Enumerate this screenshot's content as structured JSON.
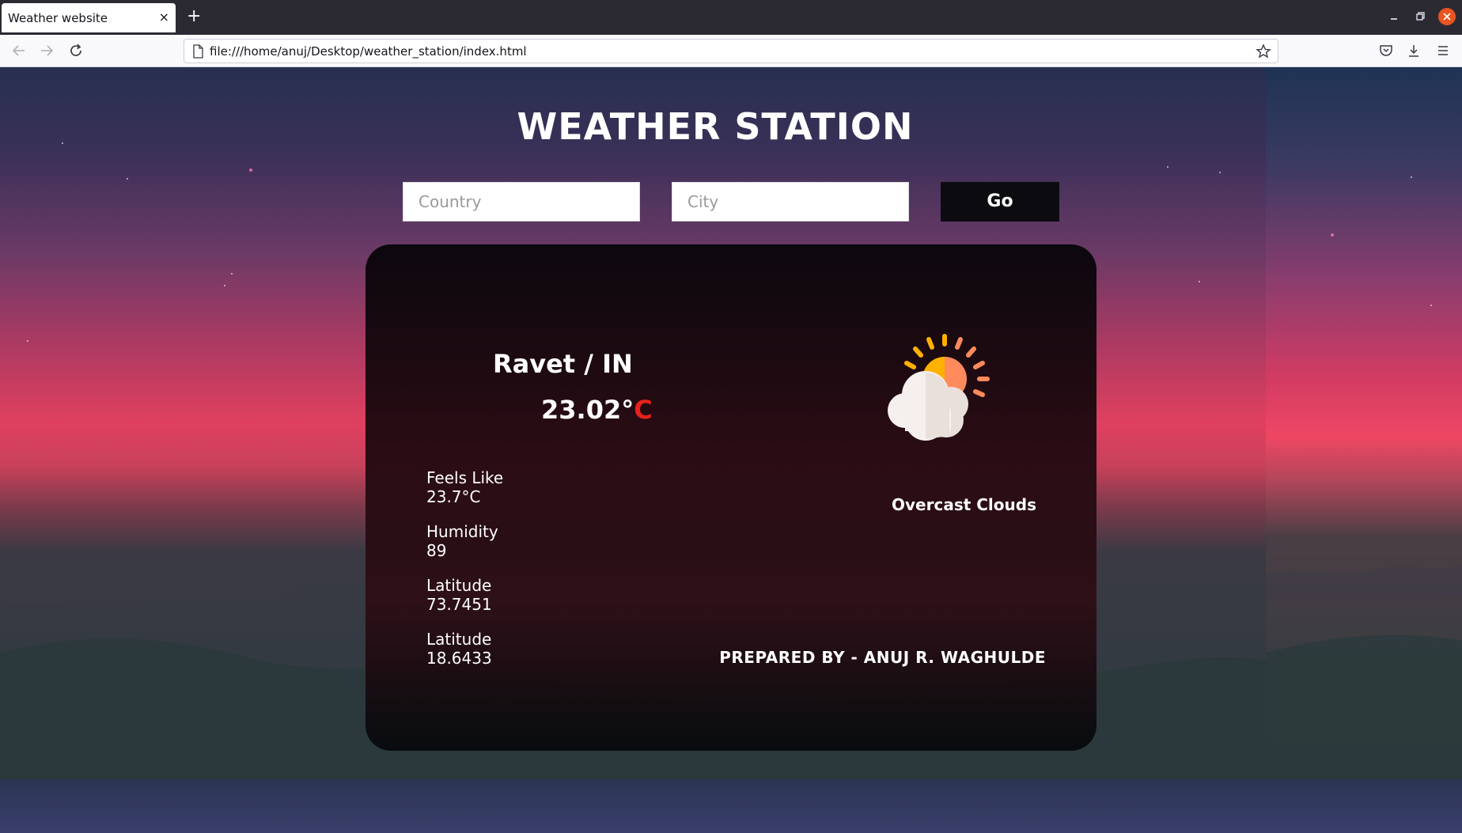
{
  "browser": {
    "tab_title": "Weather website",
    "tab_close": "×",
    "new_tab": "+",
    "url": "file:///home/anuj/Desktop/weather_station/index.html"
  },
  "page": {
    "title": "WEATHER STATION",
    "country_placeholder": "Country",
    "city_placeholder": "City",
    "go_label": "Go"
  },
  "weather": {
    "location": "Ravet / IN",
    "temp_value": "23.02°",
    "temp_unit": "C",
    "stats": [
      {
        "label": "Feels Like",
        "value": "23.7°C"
      },
      {
        "label": "Humidity",
        "value": "89"
      },
      {
        "label": "Latitude",
        "value": "73.7451"
      },
      {
        "label": "Latitude",
        "value": "18.6433"
      }
    ],
    "description": "Overcast Clouds",
    "icon": "partly-cloudy-sun-icon"
  },
  "footer": {
    "author": "PREPARED BY - ANUJ R. WAGHULDE"
  },
  "colors": {
    "accent_unit": "#e8221b",
    "go_button": "#0c0b10",
    "window_close": "#e95420"
  }
}
